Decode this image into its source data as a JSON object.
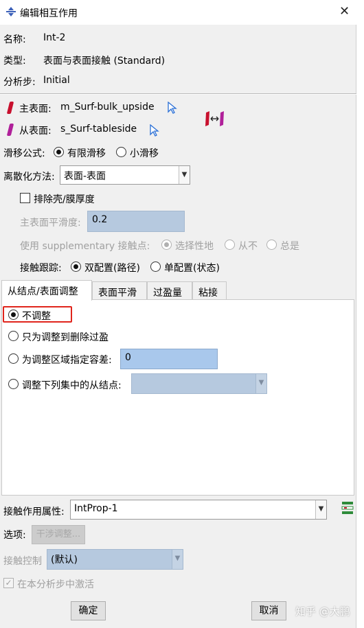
{
  "window": {
    "title": "编辑相互作用",
    "close": "✕"
  },
  "info": {
    "name_label": "名称:",
    "name_value": "Int-2",
    "type_label": "类型:",
    "type_value": "表面与表面接触 (Standard)",
    "step_label": "分析步:",
    "step_value": "Initial"
  },
  "surfaces": {
    "master_label": "主表面:",
    "master_value": "m_Surf-bulk_upside",
    "slave_label": "从表面:",
    "slave_value": "s_Surf-tableside",
    "master_color": "#c8102e",
    "slave_color": "#b0209a"
  },
  "sliding": {
    "label": "滑移公式:",
    "options": [
      "有限滑移",
      "小滑移"
    ],
    "selected": 0
  },
  "discretization": {
    "label": "离散化方法:",
    "value": "表面-表面"
  },
  "exclude_shell": {
    "label": "排除壳/膜厚度",
    "checked": false
  },
  "smoothing": {
    "label": "主表面平滑度:",
    "value": "0.2"
  },
  "supplementary": {
    "label": "使用 supplementary 接触点:",
    "options": [
      "选择性地",
      "从不",
      "总是"
    ],
    "selected": 0
  },
  "tracking": {
    "label": "接触跟踪:",
    "options": [
      "双配置(路径)",
      "单配置(状态)"
    ],
    "selected": 0
  },
  "tabs": [
    "从结点/表面调整",
    "表面平滑",
    "过盈量",
    "粘接"
  ],
  "active_tab": 0,
  "adjust": {
    "options": [
      "不调整",
      "只为调整到删除过盈",
      "为调整区域指定容差:",
      "调整下列集中的从结点:"
    ],
    "selected": 0,
    "tolerance_value": "0",
    "set_value": ""
  },
  "property": {
    "label": "接触作用属性:",
    "value": "IntProp-1"
  },
  "options_row": {
    "label": "选项:",
    "button": "干涉调整..."
  },
  "control": {
    "label": "接触控制",
    "value": "(默认)"
  },
  "activate": {
    "label": "在本分析步中激活",
    "checked": true
  },
  "buttons": {
    "ok": "确定",
    "cancel": "取消"
  },
  "watermark": "知乎 @大鹏",
  "colors": {
    "highlight": "#e0241b",
    "field_bg": "#a9c8ec"
  }
}
